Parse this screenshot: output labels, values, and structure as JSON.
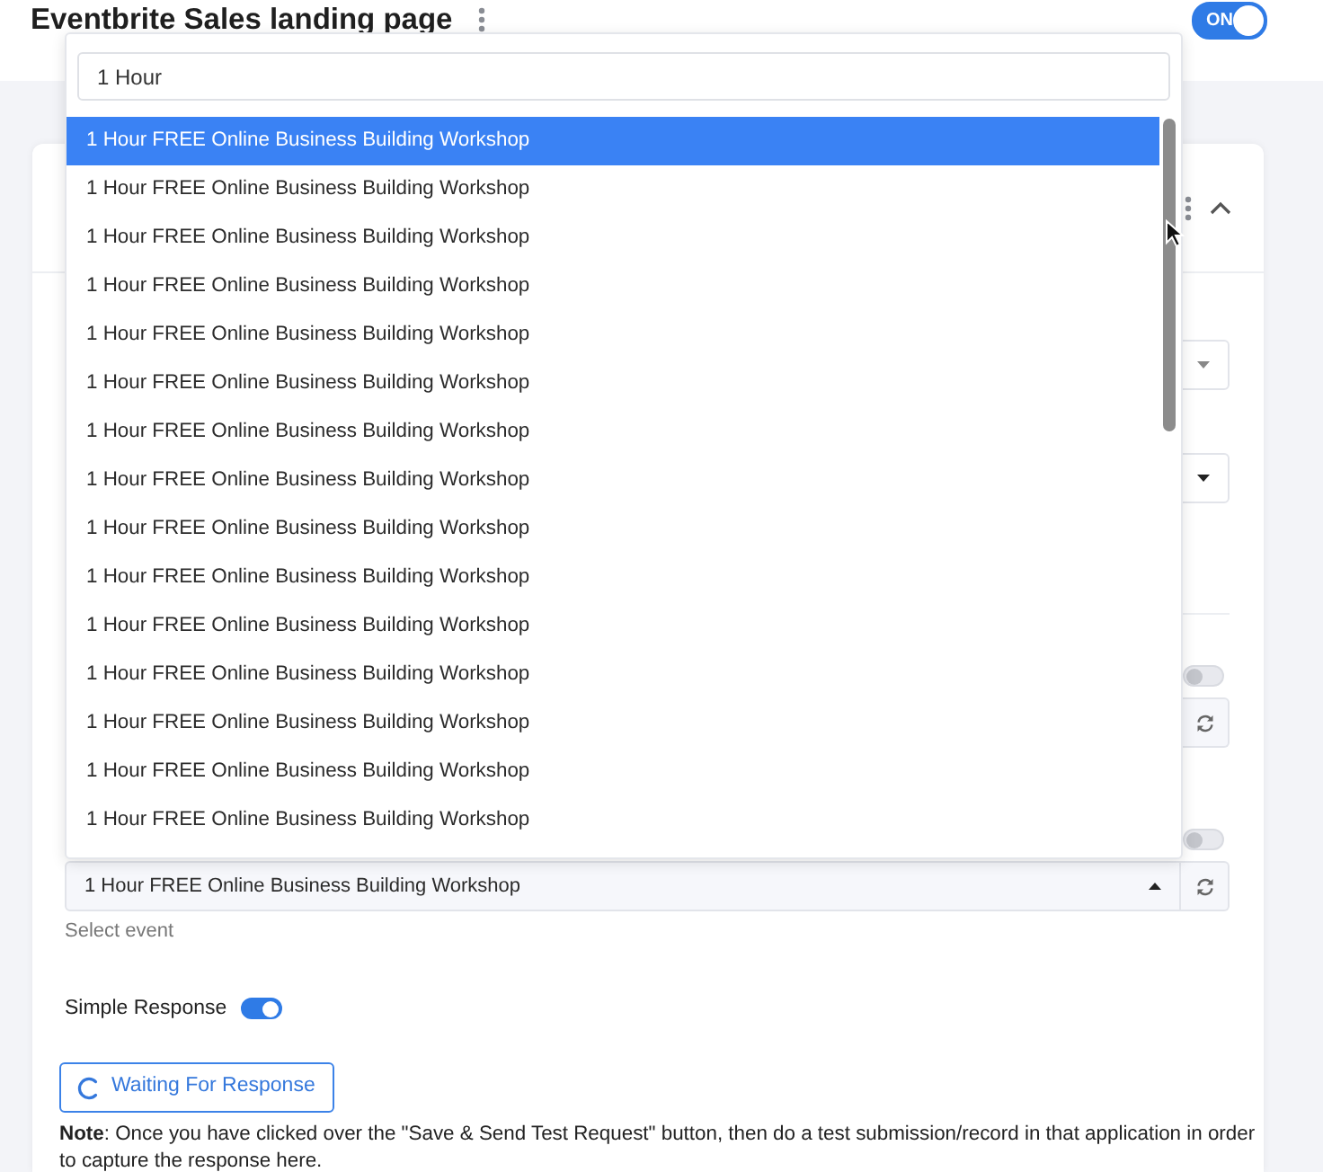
{
  "header": {
    "title": "Eventbrite Sales landing page",
    "toggle": {
      "label": "ON",
      "on": true
    }
  },
  "card": {
    "expanded": true,
    "fields": [
      {
        "kind": "select"
      },
      {
        "kind": "select"
      },
      {
        "kind": "divider"
      },
      {
        "kind": "refresh_input",
        "toggle_on": false
      },
      {
        "kind": "refresh_select",
        "toggle_on": false,
        "value": "1 Hour FREE Online Business Building Workshop",
        "expanded": true,
        "hint": "Select event",
        "dropdown": {
          "search": "1 Hour",
          "options": [
            {
              "label": "1 Hour FREE Online Business Building Workshop",
              "selected": true
            },
            {
              "label": "1 Hour FREE Online Business Building Workshop",
              "selected": false
            },
            {
              "label": "1 Hour FREE Online Business Building Workshop",
              "selected": false
            },
            {
              "label": "1 Hour FREE Online Business Building Workshop",
              "selected": false
            },
            {
              "label": "1 Hour FREE Online Business Building Workshop",
              "selected": false
            },
            {
              "label": "1 Hour FREE Online Business Building Workshop",
              "selected": false
            },
            {
              "label": "1 Hour FREE Online Business Building Workshop",
              "selected": false
            },
            {
              "label": "1 Hour FREE Online Business Building Workshop",
              "selected": false
            },
            {
              "label": "1 Hour FREE Online Business Building Workshop",
              "selected": false
            },
            {
              "label": "1 Hour FREE Online Business Building Workshop",
              "selected": false
            },
            {
              "label": "1 Hour FREE Online Business Building Workshop",
              "selected": false
            },
            {
              "label": "1 Hour FREE Online Business Building Workshop",
              "selected": false
            },
            {
              "label": "1 Hour FREE Online Business Building Workshop",
              "selected": false
            },
            {
              "label": "1 Hour FREE Online Business Building Workshop",
              "selected": false
            },
            {
              "label": "1 Hour FREE Online Business Building Workshop",
              "selected": false
            }
          ]
        }
      }
    ],
    "simple_response": {
      "label": "Simple Response",
      "on": true
    },
    "wait_button": {
      "label": "Waiting For Response"
    },
    "note": "**Note**: Once you have clicked over the \"Save & Send Test Request\" button, then do a test submission/record in that application in order to capture the response here."
  }
}
